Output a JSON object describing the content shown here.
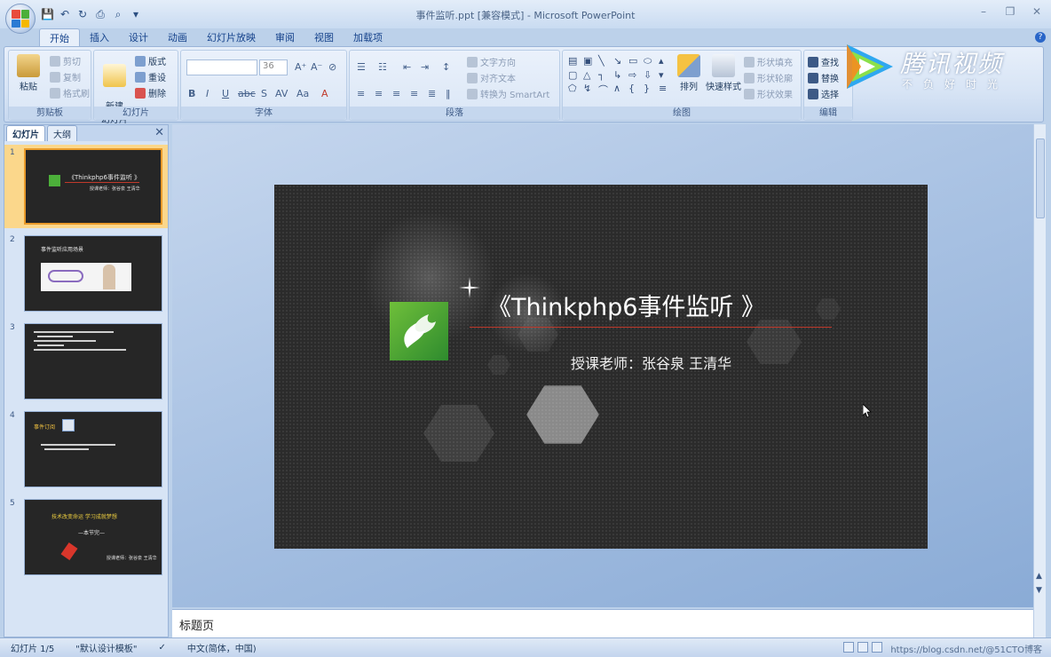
{
  "window": {
    "title": "事件监听.ppt [兼容模式] - Microsoft PowerPoint"
  },
  "ribbon": {
    "tabs": [
      "开始",
      "插入",
      "设计",
      "动画",
      "幻灯片放映",
      "审阅",
      "视图",
      "加载项"
    ],
    "active_tab": "开始",
    "clipboard": {
      "label": "剪贴板",
      "paste": "粘贴",
      "cut": "剪切",
      "copy": "复制",
      "format_painter": "格式刷"
    },
    "slides": {
      "label": "幻灯片",
      "new_slide": "新建\n幻灯片",
      "layout": "版式",
      "reset": "重设",
      "delete": "删除"
    },
    "font": {
      "label": "字体",
      "font_name": "",
      "font_size": "36"
    },
    "paragraph": {
      "label": "段落",
      "text_direction": "文字方向",
      "align_text": "对齐文本",
      "smartart": "转换为 SmartArt"
    },
    "drawing": {
      "label": "绘图",
      "arrange": "排列",
      "quick_styles": "快速样式",
      "shape_fill": "形状填充",
      "shape_outline": "形状轮廓",
      "shape_effects": "形状效果"
    },
    "editing": {
      "label": "编辑",
      "find": "查找",
      "replace": "替换",
      "select": "选择"
    }
  },
  "watermark": {
    "brand": "腾讯视频",
    "slogan": "不负好时光"
  },
  "slides_panel": {
    "tabs": [
      "幻灯片",
      "大纲"
    ],
    "thumbnails": [
      {
        "num": "1",
        "title": "《Thinkphp6事件监听 》",
        "subtitle": "授课老师：张谷泉 王清华"
      },
      {
        "num": "2",
        "title": "事件监听应用场景"
      },
      {
        "num": "3",
        "title": ""
      },
      {
        "num": "4",
        "title": "事件订阅"
      },
      {
        "num": "5",
        "title": "技术改变命运  学习成就梦想",
        "subtitle": "—本节完—",
        "footer": "授课老师：张谷泉 王清华"
      }
    ]
  },
  "slide": {
    "title": "《Thinkphp6事件监听 》",
    "subtitle": "授课老师：张谷泉    王清华"
  },
  "notes": {
    "text": "标题页"
  },
  "status_bar": {
    "slide_count": "幻灯片 1/5",
    "theme": "\"默认设计模板\"",
    "language": "中文(简体，中国)",
    "watermark_url": "https://blog.csdn.net/@51CTO博客"
  },
  "colors": {
    "ribbon_bg": "#d7e4f5",
    "slide_bg": "#2b2b2b",
    "selected_thumb": "#fbd78b",
    "title_underline": "#c0392b",
    "logo_green": "#4caf3a"
  }
}
